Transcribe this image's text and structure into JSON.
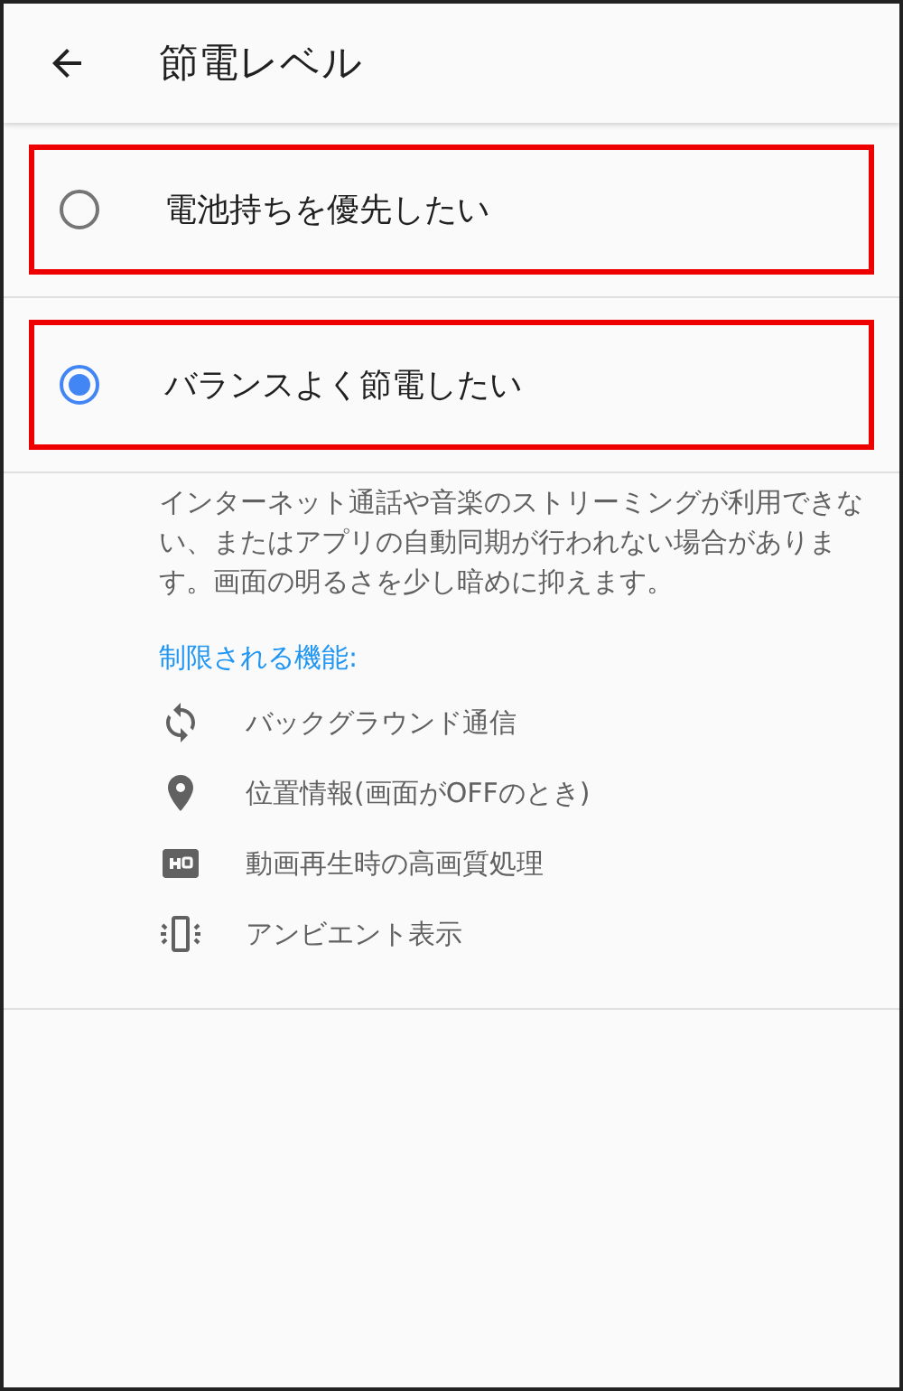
{
  "header": {
    "title": "節電レベル"
  },
  "options": [
    {
      "label": "電池持ちを優先したい",
      "selected": false,
      "highlighted": true
    },
    {
      "label": "バランスよく節電したい",
      "selected": true,
      "highlighted": true
    }
  ],
  "description": "インターネット通話や音楽のストリーミングが利用できない、またはアプリの自動同期が行われない場合があります。画面の明るさを少し暗めに抑えます。",
  "restricted_heading": "制限される機能:",
  "features": [
    {
      "kind": "sync",
      "label": "バックグラウンド通信"
    },
    {
      "kind": "location",
      "label": "位置情報(画面がOFFのとき)"
    },
    {
      "kind": "hq",
      "label": "動画再生時の高画質処理"
    },
    {
      "kind": "ambient",
      "label": "アンビエント表示"
    }
  ]
}
